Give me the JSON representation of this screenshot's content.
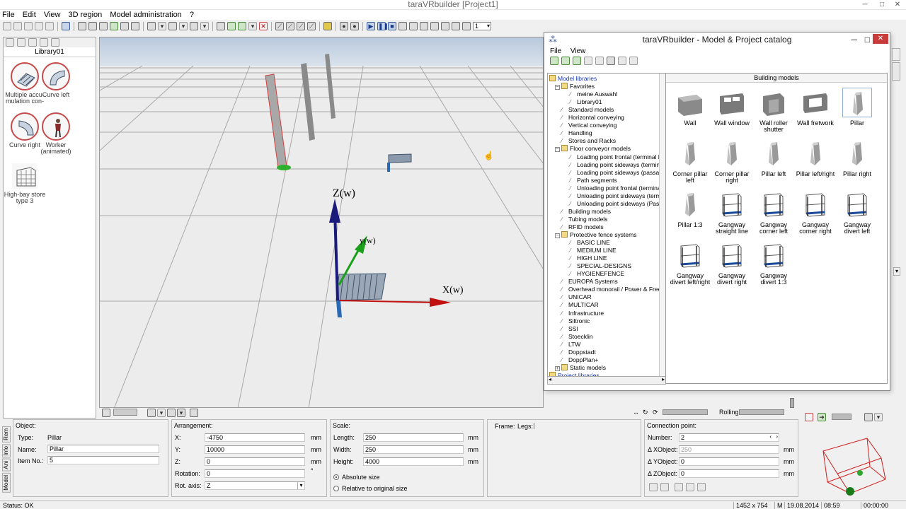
{
  "app": {
    "title": "taraVRbuilder [Project1]"
  },
  "menu": [
    "File",
    "Edit",
    "View",
    "3D region",
    "Model administration",
    "?"
  ],
  "toolbar": {
    "count_value": "1"
  },
  "left_panel": {
    "title": "Library01",
    "items": [
      {
        "label": "Multiple accu-mulation con-",
        "icon": "conveyor-icon"
      },
      {
        "label": "Curve left",
        "icon": "curve-left-icon"
      },
      {
        "label": "Curve right",
        "icon": "curve-right-icon"
      },
      {
        "label": "Worker (animated)",
        "icon": "worker-icon"
      },
      {
        "label": "High-bay store type 3",
        "icon": "rack-icon"
      }
    ]
  },
  "viewport": {
    "axes": [
      "Z(w)",
      "y(w)",
      "X(w)"
    ]
  },
  "catalog": {
    "title": "taraVRbuilder - Model & Project catalog",
    "menu": [
      "File",
      "View"
    ],
    "tree": [
      {
        "label": "Model libraries",
        "level": 0,
        "type": "folder",
        "sel": true
      },
      {
        "label": "Favorites",
        "level": 1,
        "type": "folder",
        "exp": "-"
      },
      {
        "label": "meine Auswahl",
        "level": 2,
        "type": "pin"
      },
      {
        "label": "Library01",
        "level": 2,
        "type": "pin"
      },
      {
        "label": "Standard models",
        "level": 1,
        "type": "pin"
      },
      {
        "label": "Horizontal conveying",
        "level": 1,
        "type": "pin"
      },
      {
        "label": "Vertical conveying",
        "level": 1,
        "type": "pin"
      },
      {
        "label": "Handling",
        "level": 1,
        "type": "pin"
      },
      {
        "label": "Stores and Racks",
        "level": 1,
        "type": "pin"
      },
      {
        "label": "Floor conveyor models",
        "level": 1,
        "type": "folder",
        "exp": "-"
      },
      {
        "label": "Loading point frontal (terminal line)",
        "level": 2,
        "type": "pin"
      },
      {
        "label": "Loading point sideways (terminal li",
        "level": 2,
        "type": "pin"
      },
      {
        "label": "Loading point sideways (passage)",
        "level": 2,
        "type": "pin"
      },
      {
        "label": "Path segments",
        "level": 2,
        "type": "pin"
      },
      {
        "label": "Unloading point frontal (terminal lin",
        "level": 2,
        "type": "pin"
      },
      {
        "label": "Unloading point sideways (terminal",
        "level": 2,
        "type": "pin"
      },
      {
        "label": "Unloading point sideways (Passag",
        "level": 2,
        "type": "pin"
      },
      {
        "label": "Building models",
        "level": 1,
        "type": "pin"
      },
      {
        "label": "Tubing models",
        "level": 1,
        "type": "pin"
      },
      {
        "label": "RFID models",
        "level": 1,
        "type": "pin"
      },
      {
        "label": "Protective fence systems",
        "level": 1,
        "type": "folder",
        "exp": "-"
      },
      {
        "label": "BASIC LINE",
        "level": 2,
        "type": "pin"
      },
      {
        "label": "MEDIUM LINE",
        "level": 2,
        "type": "pin"
      },
      {
        "label": "HIGH LINE",
        "level": 2,
        "type": "pin"
      },
      {
        "label": "SPECIAL-DESIGNS",
        "level": 2,
        "type": "pin"
      },
      {
        "label": "HYGIENEFENCE",
        "level": 2,
        "type": "pin"
      },
      {
        "label": "EUROPA Systems",
        "level": 1,
        "type": "pin"
      },
      {
        "label": "Overhead monorail / Power & Free",
        "level": 1,
        "type": "pin"
      },
      {
        "label": "UNICAR",
        "level": 1,
        "type": "pin"
      },
      {
        "label": "MULTICAR",
        "level": 1,
        "type": "pin"
      },
      {
        "label": "Infrastructure",
        "level": 1,
        "type": "pin"
      },
      {
        "label": "Siltronic",
        "level": 1,
        "type": "pin"
      },
      {
        "label": "SSI",
        "level": 1,
        "type": "pin"
      },
      {
        "label": "Stoecklin",
        "level": 1,
        "type": "pin"
      },
      {
        "label": "LTW",
        "level": 1,
        "type": "pin"
      },
      {
        "label": "Doppstadt",
        "level": 1,
        "type": "pin"
      },
      {
        "label": "DoppPlan+",
        "level": 1,
        "type": "pin"
      },
      {
        "label": "Static models",
        "level": 1,
        "type": "folder",
        "exp": "+"
      },
      {
        "label": "Project libraries",
        "level": 0,
        "type": "folder",
        "sel": true
      }
    ],
    "gallery_title": "Building models",
    "tiles": [
      {
        "label": "Wall",
        "kind": "wall"
      },
      {
        "label": "Wall window",
        "kind": "window"
      },
      {
        "label": "Wall roller shutter",
        "kind": "shutter"
      },
      {
        "label": "Wall fretwork",
        "kind": "fret"
      },
      {
        "label": "Pillar",
        "kind": "pillar",
        "sel": true
      },
      {
        "label": "Corner pillar left",
        "kind": "pillar"
      },
      {
        "label": "Corner pillar right",
        "kind": "pillar"
      },
      {
        "label": "Pillar left",
        "kind": "pillar"
      },
      {
        "label": "Pillar left/right",
        "kind": "pillar"
      },
      {
        "label": "Pillar right",
        "kind": "pillar"
      },
      {
        "label": "Pillar 1:3",
        "kind": "pillar"
      },
      {
        "label": "Gangway straight line",
        "kind": "gangway"
      },
      {
        "label": "Gangway corner left",
        "kind": "gangway"
      },
      {
        "label": "Gangway corner right",
        "kind": "gangway"
      },
      {
        "label": "Gangway divert left",
        "kind": "gangway"
      },
      {
        "label": "Gangway divert left/right",
        "kind": "gangway"
      },
      {
        "label": "Gangway divert right",
        "kind": "gangway"
      },
      {
        "label": "Gangway divert 1:3",
        "kind": "gangway"
      }
    ]
  },
  "viewbar": {
    "rolling": "Rolling"
  },
  "props": {
    "tabs": [
      "Model",
      "Ani",
      "Info",
      "Rem"
    ],
    "object": {
      "title": "Object:",
      "type_label": "Type:",
      "type_value": "Pillar",
      "name_label": "Name:",
      "name_value": "Pillar",
      "item_label": "Item No.:",
      "item_value": "5"
    },
    "arrangement": {
      "title": "Arrangement:",
      "x_label": "X:",
      "x_value": "-4750",
      "y_label": "Y:",
      "y_value": "10000",
      "z_label": "Z:",
      "z_value": "0",
      "rot_label": "Rotation:",
      "rot_value": "0",
      "axis_label": "Rot. axis:",
      "axis_value": "Z",
      "unit": "mm",
      "deg": "°"
    },
    "scale": {
      "title": "Scale:",
      "length_label": "Length:",
      "length_value": "250",
      "width_label": "Width:",
      "width_value": "250",
      "height_label": "Height:",
      "height_value": "4000",
      "unit": "mm",
      "abs_label": "Absolute size",
      "rel_label": "Relative to original size"
    },
    "frame": {
      "frame_label": "Frame:",
      "legs_label": "Legs:"
    },
    "connection": {
      "title": "Connection point:",
      "number_label": "Number:",
      "number_value": "2",
      "dx_label": "Δ XObject:",
      "dx_value": "250",
      "dy_label": "Δ YObject:",
      "dy_value": "0",
      "dz_label": "Δ ZObject:",
      "dz_value": "0",
      "unit": "mm"
    }
  },
  "status": {
    "text": "Status: OK",
    "resolution": "1452 x 754",
    "mode": "M",
    "date": "19.08.2014",
    "time": "08:59",
    "clock": "00:00:00"
  }
}
